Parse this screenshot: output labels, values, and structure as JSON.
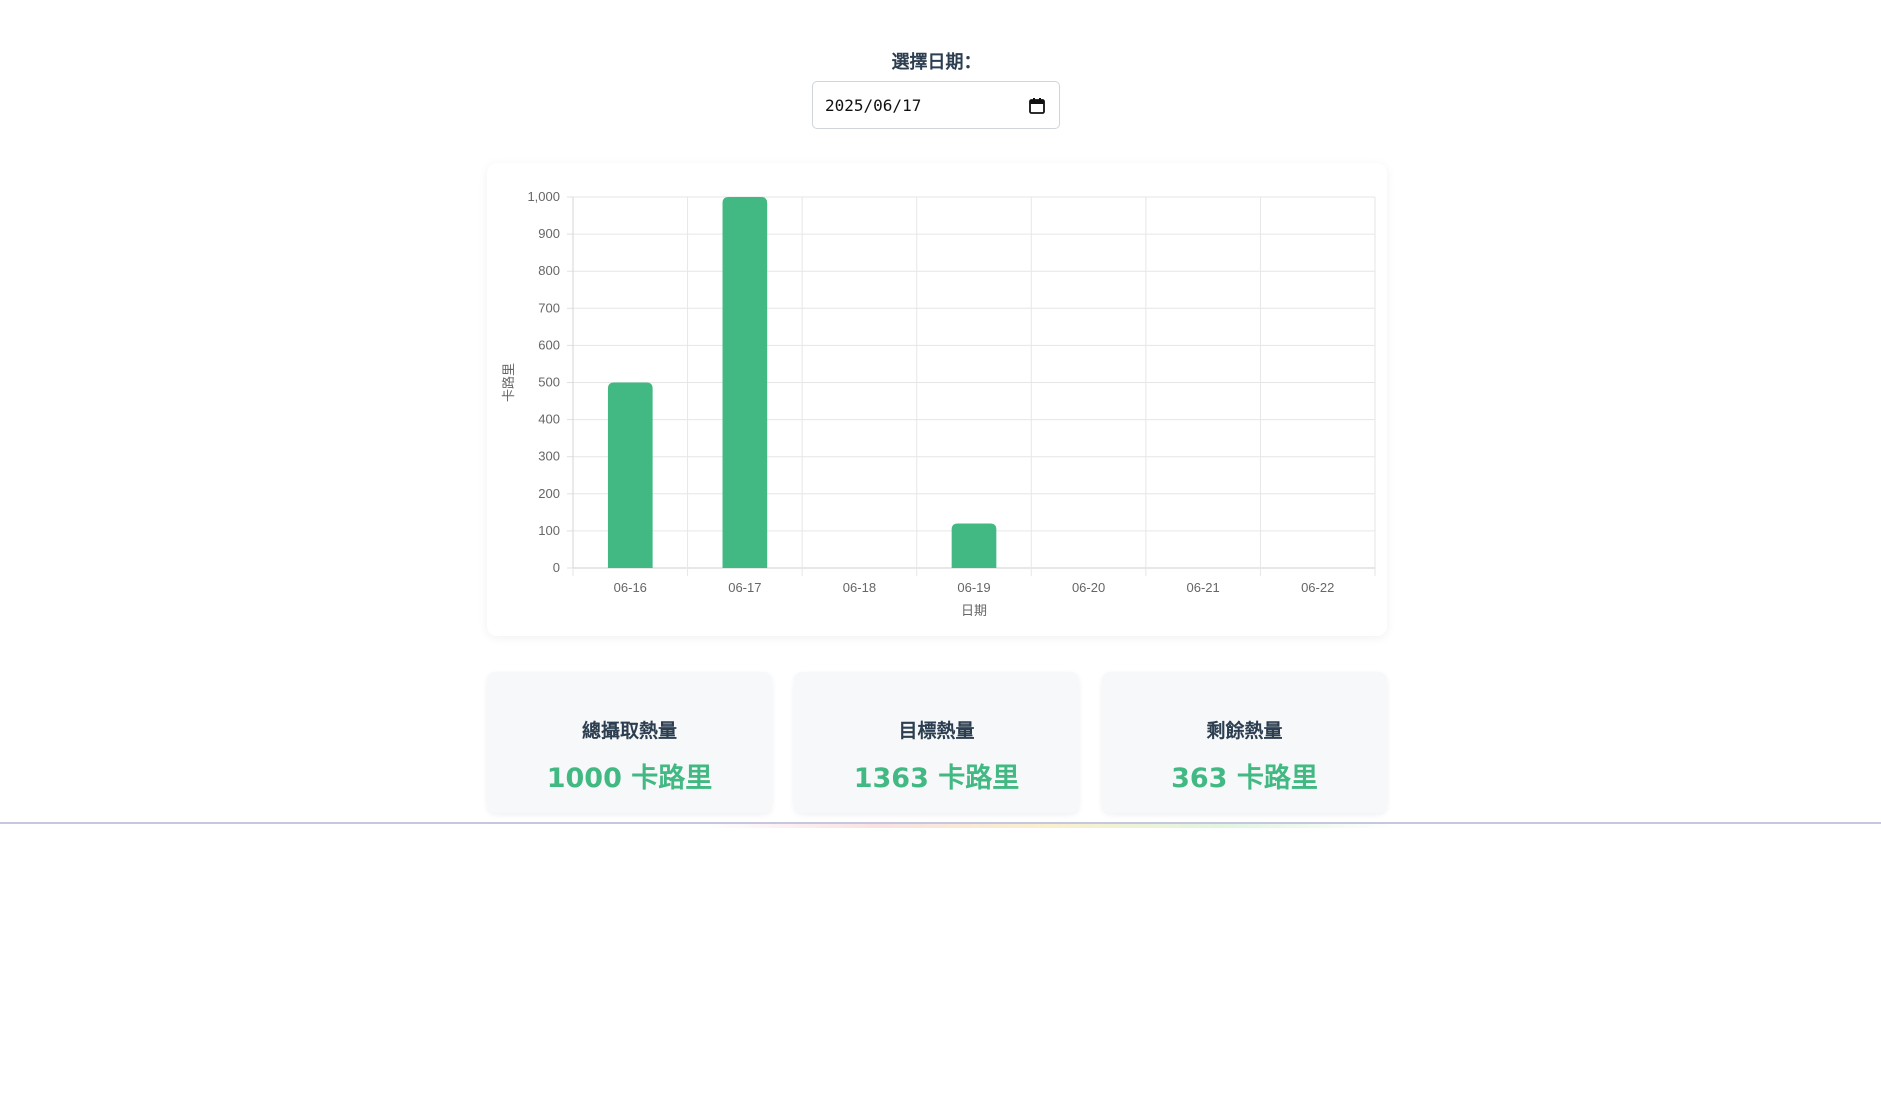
{
  "date_picker": {
    "label": "選擇日期：",
    "value": "2025/06/17"
  },
  "stats": [
    {
      "label": "總攝取熱量",
      "value": "1000 卡路里"
    },
    {
      "label": "目標熱量",
      "value": "1363 卡路里"
    },
    {
      "label": "剩餘熱量",
      "value": "363 卡路里"
    }
  ],
  "colors": {
    "accent": "#42b983",
    "heading": "#2c3e50"
  },
  "chart_data": {
    "type": "bar",
    "categories": [
      "06-16",
      "06-17",
      "06-18",
      "06-19",
      "06-20",
      "06-21",
      "06-22"
    ],
    "values": [
      500,
      1000,
      0,
      120,
      0,
      0,
      0
    ],
    "title": "",
    "xlabel": "日期",
    "ylabel": "卡路里",
    "ylim": [
      0,
      1000
    ],
    "yticks": [
      "0",
      "100",
      "200",
      "300",
      "400",
      "500",
      "600",
      "700",
      "800",
      "900",
      "1,000"
    ],
    "grid": true,
    "bar_color": "#42b983"
  }
}
